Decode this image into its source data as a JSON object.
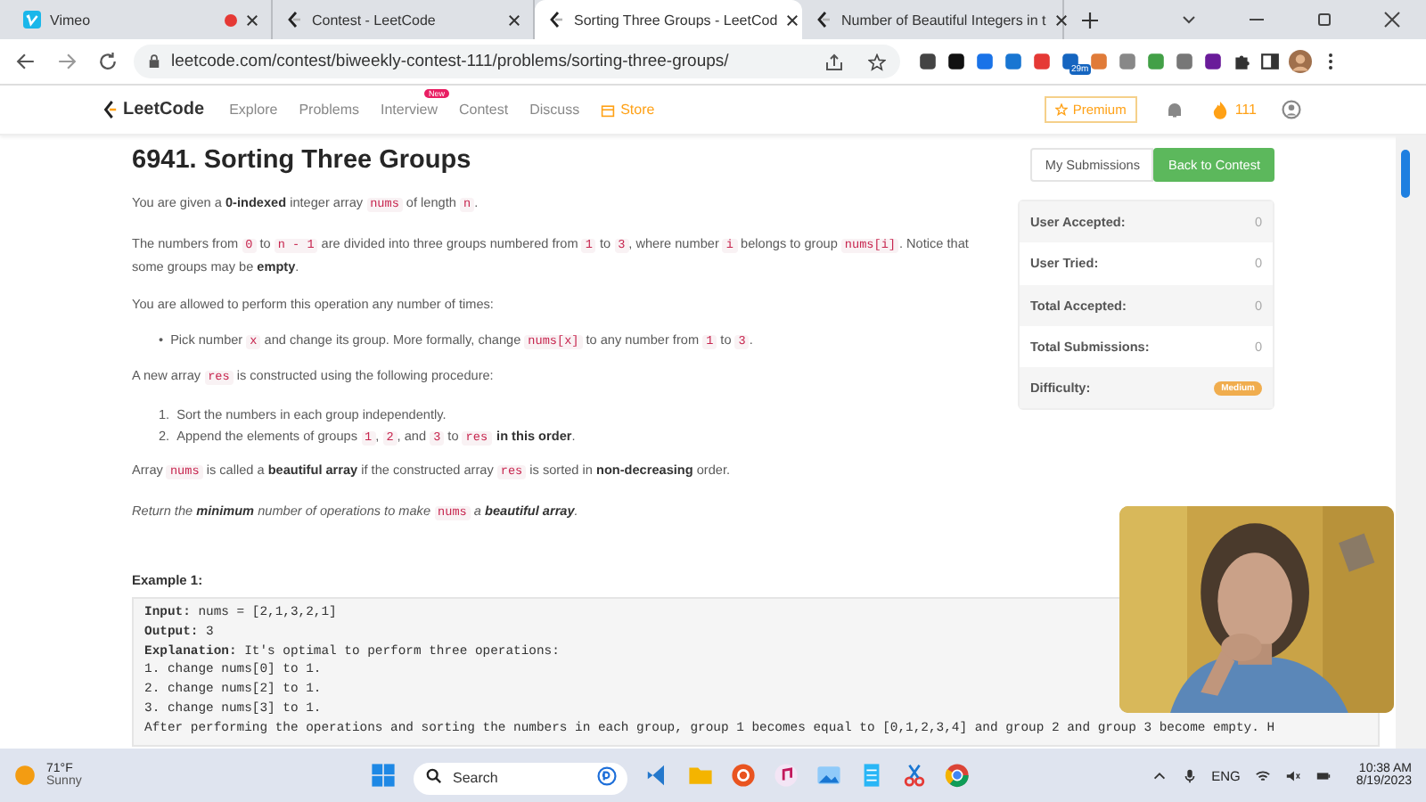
{
  "browser": {
    "tabs": [
      {
        "title": "Vimeo",
        "kind": "vimeo",
        "recording": true,
        "selected": false
      },
      {
        "title": "Contest - LeetCode",
        "kind": "leetcode",
        "recording": false,
        "selected": false
      },
      {
        "title": "Sorting Three Groups - LeetCod",
        "kind": "leetcode",
        "recording": false,
        "selected": true
      },
      {
        "title": "Number of Beautiful Integers in t",
        "kind": "leetcode",
        "recording": false,
        "selected": false
      }
    ],
    "address": "leetcode.com/contest/biweekly-contest-111/problems/sorting-three-groups/",
    "extension_badge": "29m"
  },
  "site_nav": {
    "logo": "LeetCode",
    "items": [
      {
        "label": "Explore",
        "kind": "link"
      },
      {
        "label": "Problems",
        "kind": "link"
      },
      {
        "label": "Interview",
        "kind": "link",
        "badge": "New"
      },
      {
        "label": "Contest",
        "kind": "link"
      },
      {
        "label": "Discuss",
        "kind": "link"
      },
      {
        "label": "Store",
        "kind": "store"
      }
    ],
    "premium": "Premium",
    "streak": "111"
  },
  "problem": {
    "title": "6941. Sorting Three Groups",
    "blocks": [
      {
        "kind": "p",
        "segs": [
          {
            "kind": "t",
            "s": "You are given a "
          },
          {
            "kind": "b",
            "s": "0-indexed"
          },
          {
            "kind": "t",
            "s": " integer array "
          },
          {
            "kind": "c",
            "s": "nums"
          },
          {
            "kind": "t",
            "s": " of length "
          },
          {
            "kind": "c",
            "s": "n"
          },
          {
            "kind": "t",
            "s": "."
          }
        ]
      },
      {
        "kind": "p",
        "segs": [
          {
            "kind": "t",
            "s": "The numbers from "
          },
          {
            "kind": "c",
            "s": "0"
          },
          {
            "kind": "t",
            "s": " to "
          },
          {
            "kind": "c",
            "s": "n - 1"
          },
          {
            "kind": "t",
            "s": " are divided into three groups numbered from "
          },
          {
            "kind": "c",
            "s": "1"
          },
          {
            "kind": "t",
            "s": " to "
          },
          {
            "kind": "c",
            "s": "3"
          },
          {
            "kind": "t",
            "s": ", where number "
          },
          {
            "kind": "c",
            "s": "i"
          },
          {
            "kind": "t",
            "s": " belongs to group "
          },
          {
            "kind": "c",
            "s": "nums[i]"
          },
          {
            "kind": "t",
            "s": ". Notice that some groups may be "
          },
          {
            "kind": "b",
            "s": "empty"
          },
          {
            "kind": "t",
            "s": "."
          }
        ]
      },
      {
        "kind": "p",
        "segs": [
          {
            "kind": "t",
            "s": "You are allowed to perform this operation any number of times:"
          }
        ]
      },
      {
        "kind": "li",
        "marker": "•",
        "segs": [
          {
            "kind": "t",
            "s": "Pick number "
          },
          {
            "kind": "c",
            "s": "x"
          },
          {
            "kind": "t",
            "s": " and change its group. More formally, change "
          },
          {
            "kind": "c",
            "s": "nums[x]"
          },
          {
            "kind": "t",
            "s": " to any number from "
          },
          {
            "kind": "c",
            "s": "1"
          },
          {
            "kind": "t",
            "s": " to "
          },
          {
            "kind": "c",
            "s": "3"
          },
          {
            "kind": "t",
            "s": "."
          }
        ]
      },
      {
        "kind": "p",
        "segs": [
          {
            "kind": "t",
            "s": "A new array "
          },
          {
            "kind": "c",
            "s": "res"
          },
          {
            "kind": "t",
            "s": " is constructed using the following procedure:"
          }
        ]
      },
      {
        "kind": "li",
        "marker": "1.",
        "segs": [
          {
            "kind": "t",
            "s": "Sort the numbers in each group independently."
          }
        ]
      },
      {
        "kind": "li",
        "marker": "2.",
        "segs": [
          {
            "kind": "t",
            "s": "Append the elements of groups "
          },
          {
            "kind": "c",
            "s": "1"
          },
          {
            "kind": "t",
            "s": ", "
          },
          {
            "kind": "c",
            "s": "2"
          },
          {
            "kind": "t",
            "s": ", and "
          },
          {
            "kind": "c",
            "s": "3"
          },
          {
            "kind": "t",
            "s": " to "
          },
          {
            "kind": "c",
            "s": "res"
          },
          {
            "kind": "b",
            "s": "in this order"
          },
          {
            "kind": "t",
            "s": "."
          }
        ]
      },
      {
        "kind": "p",
        "segs": [
          {
            "kind": "t",
            "s": "Array "
          },
          {
            "kind": "c",
            "s": "nums"
          },
          {
            "kind": "t",
            "s": " is called a "
          },
          {
            "kind": "b",
            "s": "beautiful array"
          },
          {
            "kind": "t",
            "s": " if the constructed array "
          },
          {
            "kind": "c",
            "s": "res"
          },
          {
            "kind": "t",
            "s": " is sorted in "
          },
          {
            "kind": "b",
            "s": "non-decreasing"
          },
          {
            "kind": "t",
            "s": " order."
          }
        ]
      },
      {
        "kind": "p",
        "segs": [
          {
            "kind": "i",
            "s": "Return the "
          },
          {
            "kind": "bi",
            "s": "minimum"
          },
          {
            "kind": "i",
            "s": " number of operations to make "
          },
          {
            "kind": "c",
            "s": "nums"
          },
          {
            "kind": "i",
            "s": " a "
          },
          {
            "kind": "bi",
            "s": "beautiful array"
          },
          {
            "kind": "i",
            "s": "."
          }
        ]
      }
    ],
    "example": {
      "title": "Example 1:",
      "lines": [
        {
          "label": "Input:",
          "text": " nums = [2,1,3,2,1]"
        },
        {
          "label": "Output:",
          "text": " 3"
        },
        {
          "label": "Explanation:",
          "text": " It's optimal to perform three operations:"
        },
        {
          "text": "1. change nums[0] to 1."
        },
        {
          "text": "2. change nums[2] to 1."
        },
        {
          "text": "3. change nums[3] to 1."
        },
        {
          "text": "After performing the operations and sorting the numbers in each group, group 1 becomes equal to [0,1,2,3,4] and group 2 and group 3 become empty. H"
        }
      ]
    }
  },
  "sidebar": {
    "buttons": [
      {
        "label": "My Submissions",
        "selected": false
      },
      {
        "label": "Back to Contest",
        "selected": true
      }
    ],
    "stats": [
      {
        "label": "User Accepted:",
        "value": "0",
        "kind": "count"
      },
      {
        "label": "User Tried:",
        "value": "0",
        "kind": "count"
      },
      {
        "label": "Total Accepted:",
        "value": "0",
        "kind": "count"
      },
      {
        "label": "Total Submissions:",
        "value": "0",
        "kind": "count"
      },
      {
        "label": "Difficulty:",
        "value": "Medium",
        "kind": "badge"
      }
    ]
  },
  "taskbar": {
    "temperature": "71°F",
    "weather": "Sunny",
    "search": {
      "placeholder": "Search"
    },
    "language": "ENG",
    "time": "10:38 AM",
    "date": "8/19/2023"
  }
}
